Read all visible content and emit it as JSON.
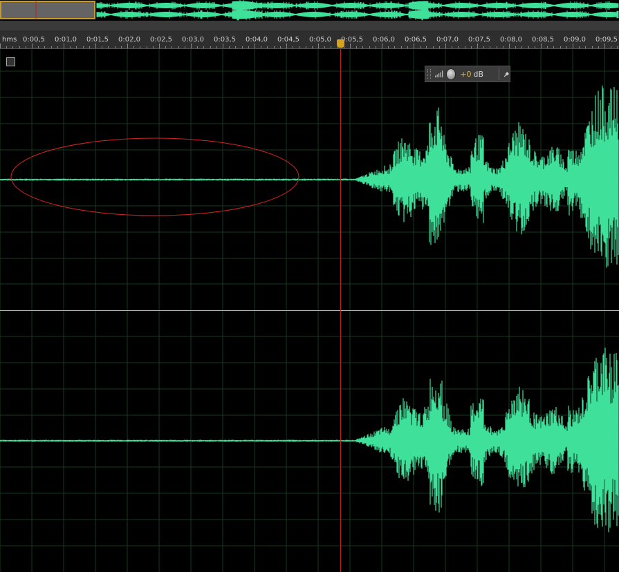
{
  "ruler": {
    "unit_label": "hms",
    "ticks": [
      "0:00,5",
      "0:01,0",
      "0:01,5",
      "0:02,0",
      "0:02,5",
      "0:03,0",
      "0:03,5",
      "0:04,0",
      "0:04,5",
      "0:05,0",
      "0:05,5",
      "0:06,0",
      "0:06,5",
      "0:07,0",
      "0:07,5",
      "0:08,0",
      "0:08,5",
      "0:09,0",
      "0:09,5"
    ]
  },
  "hud": {
    "gain_value": "+0",
    "gain_unit": "dB"
  },
  "colors": {
    "waveform": "#3fe09a",
    "playhead": "#c0201f",
    "grid": "#153a1f",
    "annotation": "#d8241f",
    "ruler_bg": "#2e2e2e"
  },
  "icons": {
    "hud_grip": "grip-icon",
    "hud_level": "level-meter-icon",
    "hud_knob": "volume-knob-icon",
    "hud_pin": "pin-icon",
    "corner": "channel-toggle-icon"
  }
}
